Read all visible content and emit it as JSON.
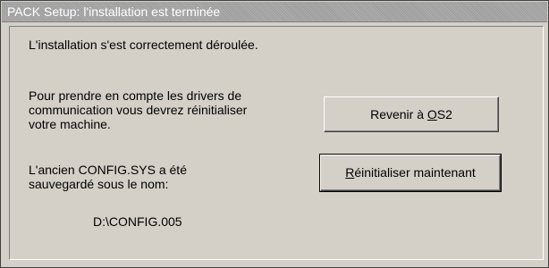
{
  "window": {
    "title": "PACK Setup: l'installation est terminée"
  },
  "messages": {
    "success": "L'installation s'est correctement déroulée.",
    "drivers": "Pour prendre en compte les drivers de\ncommunication vous devrez réinitialiser\nvotre machine.",
    "config": "L'ancien CONFIG.SYS a été\nsauvegardé sous le nom:",
    "backup_path": "D:\\CONFIG.005"
  },
  "buttons": {
    "back": {
      "label_pre": "Revenir à ",
      "label_mnemonic": "O",
      "label_post": "S2"
    },
    "reboot": {
      "label_pre": "",
      "label_mnemonic": "R",
      "label_post": "éinitialiser maintenant"
    }
  }
}
